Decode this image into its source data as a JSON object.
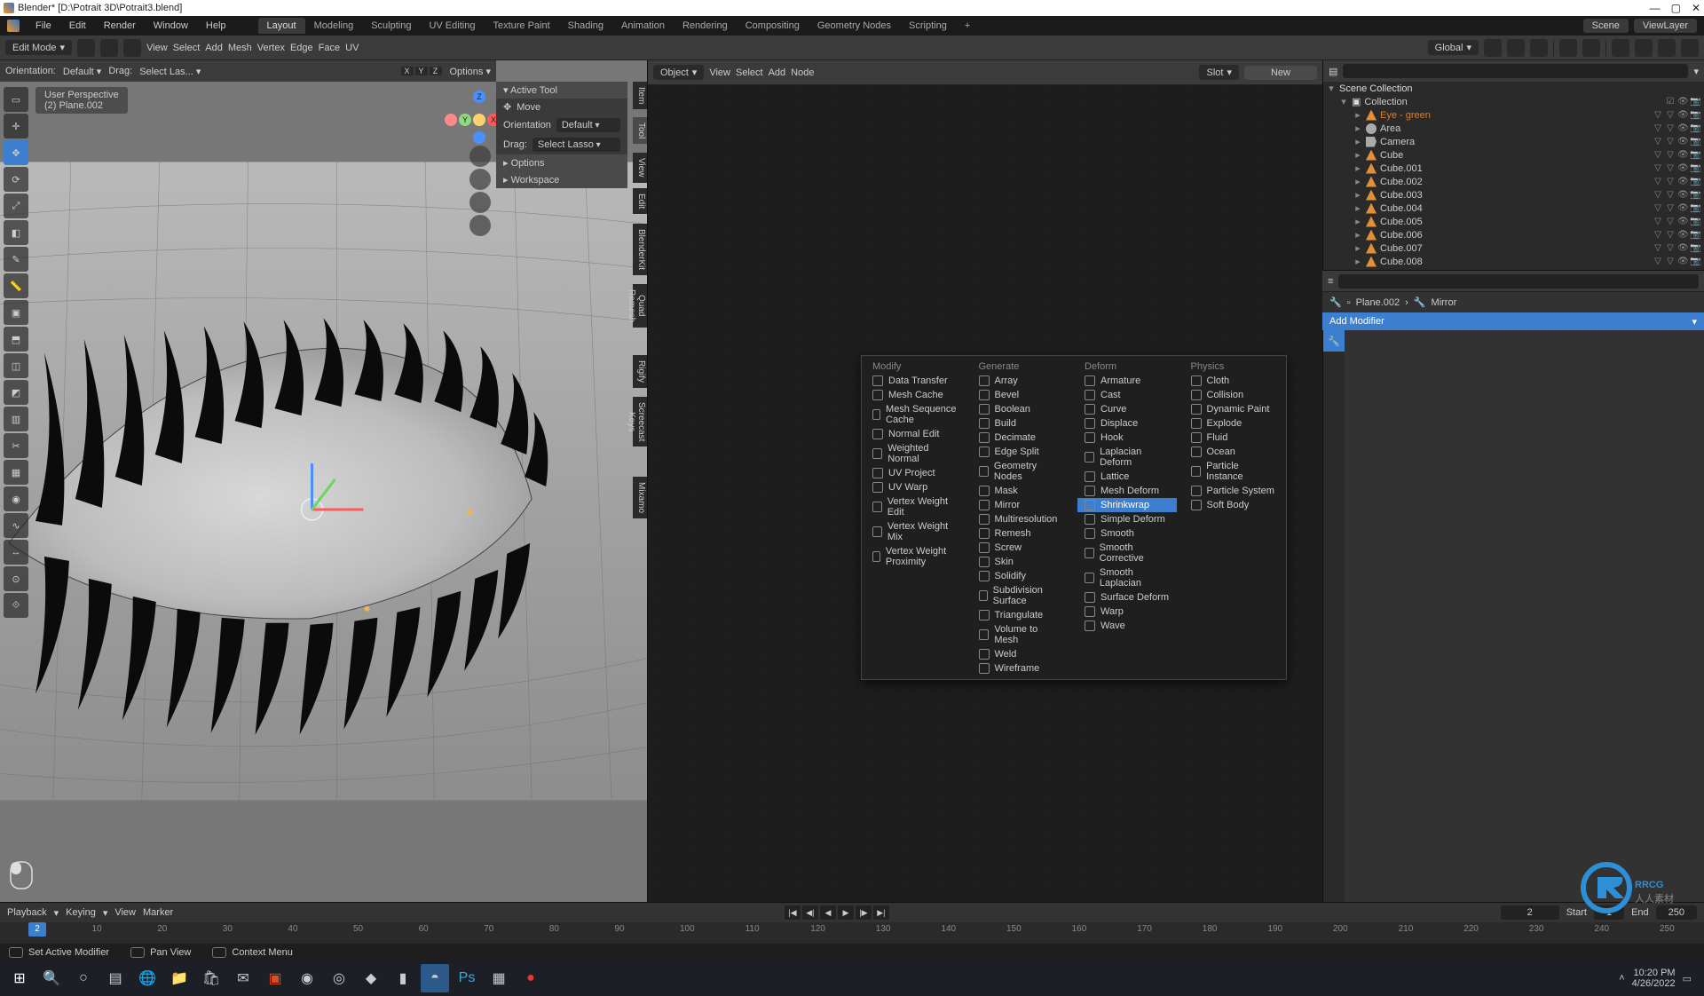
{
  "title": "Blender* [D:\\Potrait 3D\\Potrait3.blend]",
  "menubar": [
    "File",
    "Edit",
    "Render",
    "Window",
    "Help"
  ],
  "workspaces": [
    "Layout",
    "Modeling",
    "Sculpting",
    "UV Editing",
    "Texture Paint",
    "Shading",
    "Animation",
    "Rendering",
    "Compositing",
    "Geometry Nodes",
    "Scripting",
    "+"
  ],
  "active_workspace": "Layout",
  "header_right": {
    "scene": "Scene",
    "viewlayer": "ViewLayer"
  },
  "vp_toolbar": {
    "mode": "Edit Mode",
    "menus": [
      "View",
      "Select",
      "Add",
      "Mesh",
      "Vertex",
      "Edge",
      "Face",
      "UV"
    ],
    "transform_orient": "Global"
  },
  "vp_sub": {
    "orientation_label": "Orientation:",
    "orientation": "Default",
    "drag_label": "Drag:",
    "drag": "Select Las...",
    "axes": [
      "X",
      "Y",
      "Z"
    ],
    "options": "Options"
  },
  "vp_header": {
    "line1": "User Perspective",
    "line2": "(2) Plane.002"
  },
  "tool_panel": {
    "title": "Active Tool",
    "tool": "Move",
    "orientation_label": "Orientation",
    "orientation": "Default",
    "drag_label": "Drag:",
    "drag": "Select Lasso",
    "options": "Options",
    "workspace": "Workspace"
  },
  "side_tabs": [
    "Item",
    "Tool",
    "View",
    "Edit",
    "BlenderKit",
    "Quad Remesh",
    "Rigify",
    "Screecast Keys",
    "Mixamo"
  ],
  "node_toolbar": {
    "mode": "Object",
    "menus": [
      "View",
      "Select",
      "Add",
      "Node"
    ],
    "slot": "Slot",
    "new": "New"
  },
  "outliner": {
    "root": "Scene Collection",
    "collection": "Collection",
    "items": [
      {
        "name": "Eye - green",
        "type": "obj",
        "sel": true
      },
      {
        "name": "Area",
        "type": "light"
      },
      {
        "name": "Camera",
        "type": "cam"
      },
      {
        "name": "Cube",
        "type": "obj"
      },
      {
        "name": "Cube.001",
        "type": "obj"
      },
      {
        "name": "Cube.002",
        "type": "obj"
      },
      {
        "name": "Cube.003",
        "type": "obj"
      },
      {
        "name": "Cube.004",
        "type": "obj"
      },
      {
        "name": "Cube.005",
        "type": "obj"
      },
      {
        "name": "Cube.006",
        "type": "obj"
      },
      {
        "name": "Cube.007",
        "type": "obj"
      },
      {
        "name": "Cube.008",
        "type": "obj"
      }
    ]
  },
  "breadcrumb": {
    "obj": "Plane.002",
    "mod": "Mirror"
  },
  "add_modifier": "Add Modifier",
  "modifier_menu": {
    "columns": [
      {
        "title": "Modify",
        "items": [
          "Data Transfer",
          "Mesh Cache",
          "Mesh Sequence Cache",
          "Normal Edit",
          "Weighted Normal",
          "UV Project",
          "UV Warp",
          "Vertex Weight Edit",
          "Vertex Weight Mix",
          "Vertex Weight Proximity"
        ]
      },
      {
        "title": "Generate",
        "items": [
          "Array",
          "Bevel",
          "Boolean",
          "Build",
          "Decimate",
          "Edge Split",
          "Geometry Nodes",
          "Mask",
          "Mirror",
          "Multiresolution",
          "Remesh",
          "Screw",
          "Skin",
          "Solidify",
          "Subdivision Surface",
          "Triangulate",
          "Volume to Mesh",
          "Weld",
          "Wireframe"
        ]
      },
      {
        "title": "Deform",
        "items": [
          "Armature",
          "Cast",
          "Curve",
          "Displace",
          "Hook",
          "Laplacian Deform",
          "Lattice",
          "Mesh Deform",
          "Shrinkwrap",
          "Simple Deform",
          "Smooth",
          "Smooth Corrective",
          "Smooth Laplacian",
          "Surface Deform",
          "Warp",
          "Wave"
        ],
        "selected": "Shrinkwrap"
      },
      {
        "title": "Physics",
        "items": [
          "Cloth",
          "Collision",
          "Dynamic Paint",
          "Explode",
          "Fluid",
          "Ocean",
          "Particle Instance",
          "Particle System",
          "Soft Body"
        ]
      }
    ]
  },
  "timeline": {
    "playback": "Playback",
    "keying": "Keying",
    "view": "View",
    "marker": "Marker",
    "current": 2,
    "start_label": "Start",
    "start": 1,
    "end_label": "End",
    "end": 250,
    "ticks": [
      10,
      20,
      30,
      40,
      50,
      60,
      70,
      80,
      90,
      100,
      110,
      120,
      130,
      140,
      150,
      160,
      170,
      180,
      190,
      200,
      210,
      220,
      230,
      240,
      250
    ]
  },
  "status": {
    "active": "Set Active Modifier",
    "pan": "Pan View",
    "ctx": "Context Menu"
  },
  "clock": {
    "time": "10:20 PM",
    "date": "4/26/2022"
  }
}
